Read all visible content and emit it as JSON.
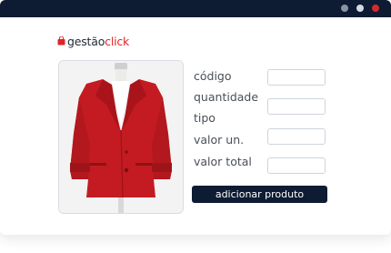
{
  "window": {
    "controls": [
      {
        "name": "minimize",
        "color": "#8a93a3"
      },
      {
        "name": "maximize",
        "color": "#d6dbe3"
      },
      {
        "name": "close",
        "color": "#d62a2a"
      }
    ]
  },
  "brand": {
    "name_part1": "gestão",
    "name_part2": "click",
    "icon": "shopping-bag-icon",
    "color_primary": "#222a36",
    "color_accent": "#e02626"
  },
  "product_image": {
    "icon": "red-coat-on-mannequin",
    "color": "#c81e24"
  },
  "form": {
    "fields": [
      {
        "label": "código",
        "value": ""
      },
      {
        "label": "quantidade",
        "value": ""
      },
      {
        "label": "tipo",
        "value": ""
      },
      {
        "label": "valor un.",
        "value": ""
      },
      {
        "label": "valor total",
        "value": ""
      }
    ],
    "submit_label": "adicionar produto"
  }
}
